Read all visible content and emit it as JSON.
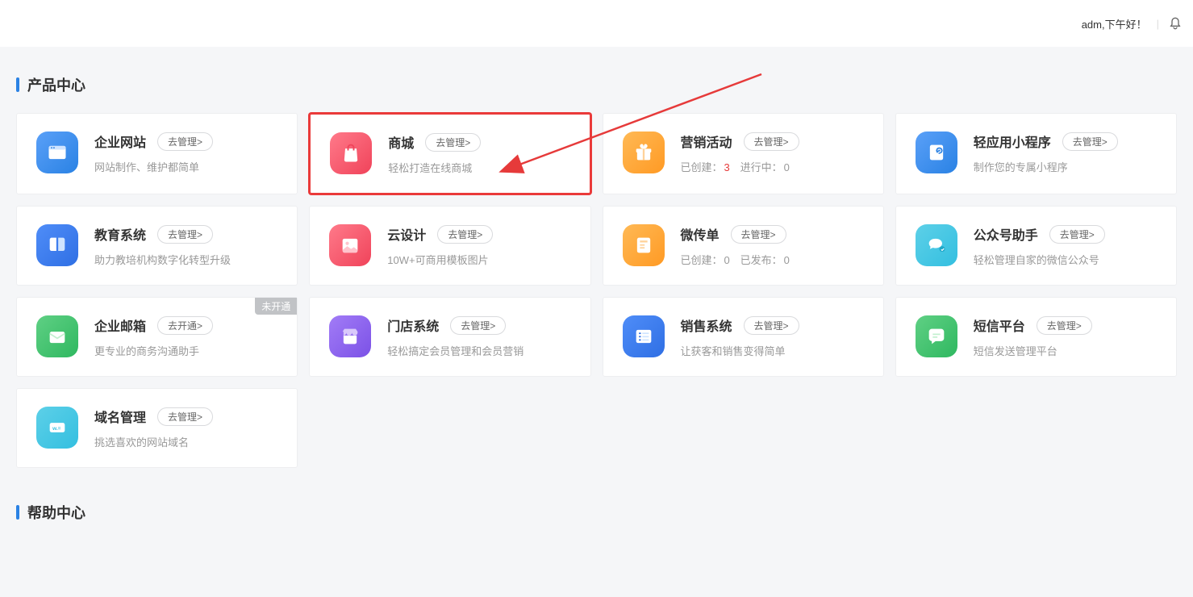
{
  "topbar": {
    "greeting": "adm,下午好！"
  },
  "sections": {
    "product_center": "产品中心",
    "help_center": "帮助中心"
  },
  "cards": [
    {
      "title": "企业网站",
      "btn": "去管理>",
      "desc": "网站制作、维护都简单"
    },
    {
      "title": "商城",
      "btn": "去管理>",
      "desc": "轻松打造在线商城"
    },
    {
      "title": "营销活动",
      "btn": "去管理>",
      "created_label": "已创建：",
      "created": "3",
      "progress_label": "进行中：",
      "progress": "0"
    },
    {
      "title": "轻应用小程序",
      "btn": "去管理>",
      "desc": "制作您的专属小程序"
    },
    {
      "title": "教育系统",
      "btn": "去管理>",
      "desc": "助力教培机构数字化转型升级"
    },
    {
      "title": "云设计",
      "btn": "去管理>",
      "desc": "10W+可商用模板图片"
    },
    {
      "title": "微传单",
      "btn": "去管理>",
      "created_label": "已创建：",
      "created": "0",
      "pub_label": "已发布：",
      "pub": "0"
    },
    {
      "title": "公众号助手",
      "btn": "去管理>",
      "desc": "轻松管理自家的微信公众号"
    },
    {
      "title": "企业邮箱",
      "btn": "去开通>",
      "desc": "更专业的商务沟通助手",
      "badge": "未开通"
    },
    {
      "title": "门店系统",
      "btn": "去管理>",
      "desc": "轻松搞定会员管理和会员营销"
    },
    {
      "title": "销售系统",
      "btn": "去管理>",
      "desc": "让获客和销售变得简单"
    },
    {
      "title": "短信平台",
      "btn": "去管理>",
      "desc": "短信发送管理平台"
    },
    {
      "title": "域名管理",
      "btn": "去管理>",
      "desc": "挑选喜欢的网站域名"
    }
  ]
}
